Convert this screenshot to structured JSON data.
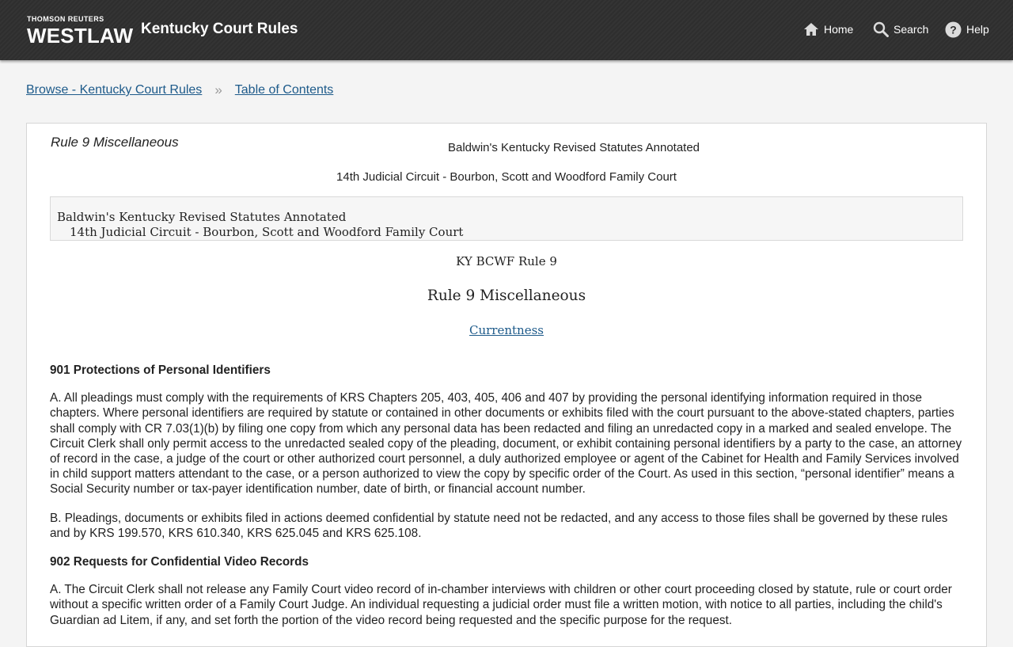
{
  "header": {
    "brand_top": "THOMSON REUTERS",
    "brand_main": "WESTLAW",
    "app_title": "Kentucky Court Rules",
    "nav": {
      "home": "Home",
      "search": "Search",
      "help": "Help"
    }
  },
  "breadcrumb": {
    "items": [
      "Browse - Kentucky Court Rules",
      "Table of Contents"
    ],
    "separator": "»"
  },
  "document": {
    "rule_heading": "Rule 9 Miscellaneous",
    "publication": "Baldwin's Kentucky Revised Statutes Annotated",
    "circuit": "14th Judicial Circuit - Bourbon, Scott and Woodford Family Court",
    "citebox": {
      "line1": "Baldwin's Kentucky Revised Statutes Annotated",
      "line2": "14th Judicial Circuit - Bourbon, Scott and Woodford Family Court"
    },
    "citation": "KY BCWF Rule 9",
    "title": "Rule 9 Miscellaneous",
    "currentness_link": "Currentness",
    "sections": [
      {
        "heading": "901 Protections of Personal Identifiers",
        "paragraphs": [
          "A. All pleadings must comply with the requirements of KRS Chapters 205, 403, 405, 406 and 407 by providing the personal identifying information required in those chapters. Where personal identifiers are required by statute or contained in other documents or exhibits filed with the court pursuant to the above-stated chapters, parties shall comply with CR 7.03(1)(b) by filing one copy from which any personal data has been redacted and filing an unredacted copy in a marked and sealed envelope. The Circuit Clerk shall only permit access to the unredacted sealed copy of the pleading, document, or exhibit containing personal identifiers by a party to the case, an attorney of record in the case, a judge of the court or other authorized court personnel, a duly authorized employee or agent of the Cabinet for Health and Family Services involved in child support matters attendant to the case, or a person authorized to view the copy by specific order of the Court. As used in this section, “personal identifier” means a Social Security number or tax-payer identification number, date of birth, or financial account number.",
          "B. Pleadings, documents or exhibits filed in actions deemed confidential by statute need not be redacted, and any access to those files shall be governed by these rules and by KRS 199.570, KRS 610.340, KRS 625.045 and KRS 625.108."
        ]
      },
      {
        "heading": "902 Requests for Confidential Video Records",
        "paragraphs": [
          "A. The Circuit Clerk shall not release any Family Court video record of in-chamber interviews with children or other court proceeding closed by statute, rule or court order without a specific written order of a Family Court Judge. An individual requesting a judicial order must file a written motion, with notice to all parties, including the child's Guardian ad Litem, if any, and set forth the portion of the video record being requested and the specific purpose for the request."
        ]
      }
    ]
  }
}
